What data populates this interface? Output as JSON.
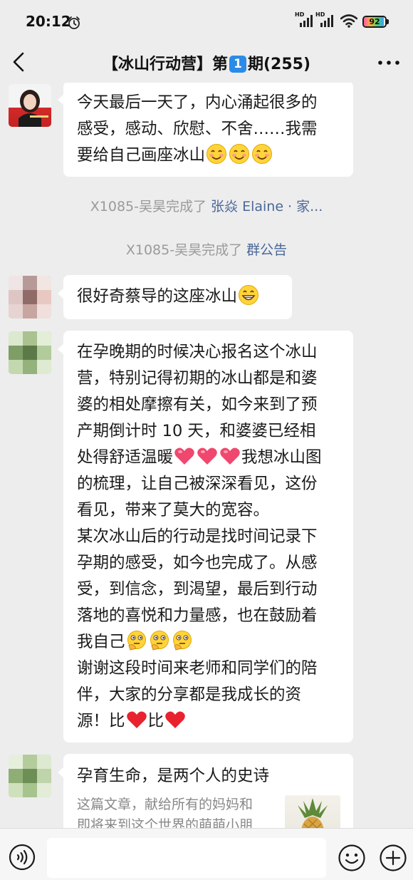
{
  "status_bar": {
    "time": "20:12",
    "battery": "92",
    "battery_level": 0.92,
    "signal_labels": [
      "HD",
      "HD"
    ]
  },
  "header": {
    "title_prefix": "【冰山行动营】第",
    "title_badge": "1",
    "title_suffix": "期(255)"
  },
  "messages": [
    {
      "type": "text",
      "lines": [
        "今天最后一天了，内心涌起很多的",
        "感受，感动、欣慰、不舍……我需",
        "要给自己画座冰山"
      ],
      "trailing_emoji": "smile-blush-emoji",
      "emoji_count": 3
    },
    {
      "type": "system",
      "text": "X1085-吴昊完成了",
      "link": "张焱 Elaine · 家..."
    },
    {
      "type": "system",
      "text": "X1085-吴昊完成了",
      "link": "群公告"
    },
    {
      "type": "text",
      "lines": [
        "很好奇蔡导的这座冰山"
      ],
      "trailing_emoji": "grin-emoji",
      "emoji_count": 1
    },
    {
      "type": "text",
      "lines": [
        "在孕晚期的时候决心报名这个冰山",
        "营，特别记得初期的冰山都是和婆",
        "婆的相处摩擦有关，如今来到了预",
        "产期倒计时 10 天，和婆婆已经相",
        "处得舒适温暖",
        "的梳理，让自己被深深看见，这份",
        "看见，带来了莫大的宽容。",
        "某次冰山后的行动是找时间记录下",
        "孕期的感受，如今也完成了。从感",
        "受，到信念，到渴望，最后到行动",
        "落地的喜悦和力量感，也在鼓励着",
        "我自己",
        "谢谢这段时间来老师和同学们的陪",
        "伴，大家的分享都是我成长的资",
        "源！比",
        "比"
      ],
      "inline_after_line4": "我想冰山图"
    },
    {
      "type": "link-card",
      "title": "孕育生命，是两个人的史诗",
      "desc_lines": [
        "这篇文章，献给所有的妈妈和",
        "即将来到这个世界的萌萌小朋"
      ]
    }
  ],
  "input_bar": {
    "icons": [
      "voice-icon",
      "emoji-icon",
      "plus-icon"
    ]
  },
  "colors": {
    "background": "#ededed",
    "bubble": "#ffffff",
    "link": "#4a6899",
    "system_text": "#9a9a9a",
    "badge": "#2b8be6",
    "heart": "#f0476e"
  }
}
